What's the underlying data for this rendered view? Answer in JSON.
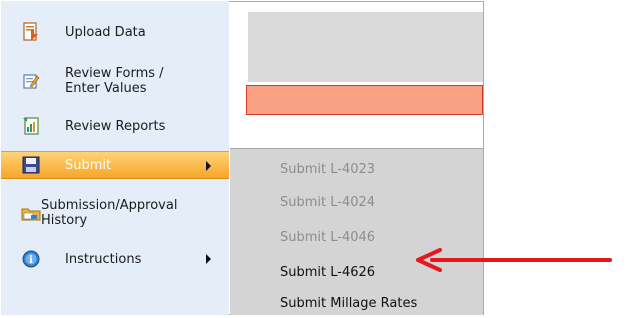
{
  "sidebar": {
    "items": [
      {
        "label_line1": "Upload Data",
        "label_line2": "",
        "icon": "upload-data-icon"
      },
      {
        "label_line1": "Review Forms /",
        "label_line2": "Enter Values",
        "icon": "review-forms-icon"
      },
      {
        "label_line1": "Review Reports",
        "label_line2": "",
        "icon": "review-reports-icon"
      },
      {
        "label_line1": "Submit",
        "label_line2": "",
        "icon": "floppy-disk-icon",
        "active": true,
        "has_submenu": true
      },
      {
        "label_line1": "Submission/Approval",
        "label_line2": "History",
        "icon": "history-folder-icon"
      },
      {
        "label_line1": "Instructions",
        "label_line2": "",
        "icon": "info-icon",
        "has_submenu": true
      }
    ]
  },
  "submenu": {
    "items": [
      {
        "label": "Submit L-4023",
        "enabled": false
      },
      {
        "label": "Submit L-4024",
        "enabled": false
      },
      {
        "label": "Submit L-4046",
        "enabled": false
      },
      {
        "label": "Submit L-4626",
        "enabled": true
      },
      {
        "label": "Submit Millage Rates",
        "enabled": true
      }
    ]
  },
  "colors": {
    "sidebar_bg": "#e4edf8",
    "active_item": "#f7a628",
    "alert_bar": "#f9a283",
    "annotation_arrow": "#e3191c"
  }
}
